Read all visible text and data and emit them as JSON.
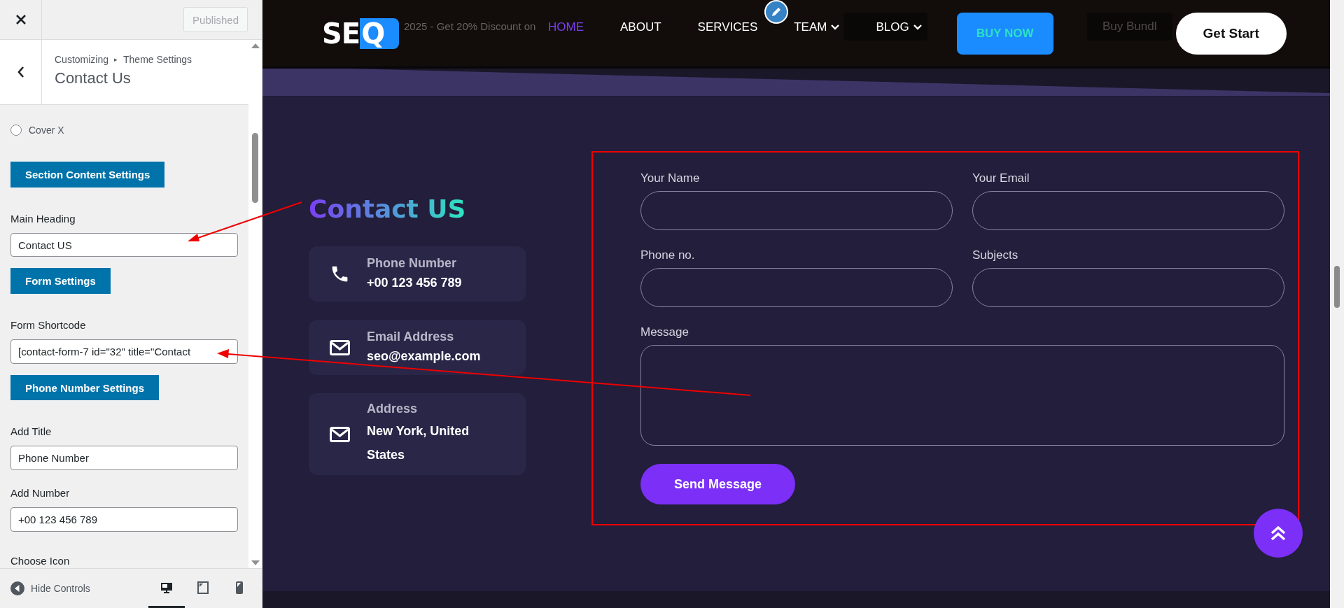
{
  "customizer": {
    "publish_button": "Published",
    "breadcrumb": {
      "parent": "Customizing",
      "separator": "▸",
      "current": "Theme Settings"
    },
    "section_title": "Contact Us",
    "controls": [
      {
        "kind": "radio",
        "label": "Cover X",
        "checked": false
      },
      {
        "kind": "section_button",
        "label": "Section Content Settings"
      },
      {
        "kind": "text_field",
        "label": "Main Heading",
        "value": "Contact US"
      },
      {
        "kind": "section_button",
        "label": "Form Settings"
      },
      {
        "kind": "text_field",
        "label": "Form Shortcode",
        "value": "[contact-form-7 id=\"32\" title=\"Contact"
      },
      {
        "kind": "section_button",
        "label": "Phone Number Settings"
      },
      {
        "kind": "text_field",
        "label": "Add Title",
        "value": "Phone Number"
      },
      {
        "kind": "text_field",
        "label": "Add Number",
        "value": "+00 123 456 789"
      },
      {
        "kind": "heading",
        "label": "Choose Icon"
      }
    ],
    "footer": {
      "hide_controls": "Hide Controls",
      "devices": [
        {
          "kind": "desktop",
          "selected": true
        },
        {
          "kind": "tablet",
          "selected": false
        },
        {
          "kind": "mobile",
          "selected": false
        }
      ]
    }
  },
  "preview": {
    "promo": [
      {
        "kind": "text",
        "text": "2025 - Get 20% Discount on"
      },
      {
        "kind": "button",
        "text": "Buy Bundl"
      }
    ],
    "logo": {
      "text": "SE",
      "mark": "Q"
    },
    "nav": [
      {
        "label": "HOME",
        "selected": true,
        "dropdown": false
      },
      {
        "label": "ABOUT",
        "selected": false,
        "dropdown": false
      },
      {
        "label": "SERVICES",
        "selected": false,
        "dropdown": false
      },
      {
        "label": "TEAM",
        "selected": false,
        "dropdown": true
      },
      {
        "label": "BLOG",
        "selected": false,
        "dropdown": true
      }
    ],
    "buy_button": "BUY NOW",
    "start_button": "Get Start",
    "contact": {
      "heading": "Contact US",
      "cards": [
        {
          "kind": "phone",
          "title": "Phone Number",
          "value": "+00 123 456 789"
        },
        {
          "kind": "email",
          "title": "Email Address",
          "value": "seo@example.com"
        },
        {
          "kind": "email",
          "title": "Address",
          "value": "New York, United States"
        }
      ]
    },
    "form": {
      "fields": [
        {
          "kind": "input",
          "label": "Your Name"
        },
        {
          "kind": "input",
          "label": "Your Email"
        },
        {
          "kind": "input",
          "label": "Phone no."
        },
        {
          "kind": "input",
          "label": "Subjects"
        },
        {
          "kind": "textarea",
          "label": "Message"
        }
      ],
      "submit": "Send Message"
    }
  }
}
